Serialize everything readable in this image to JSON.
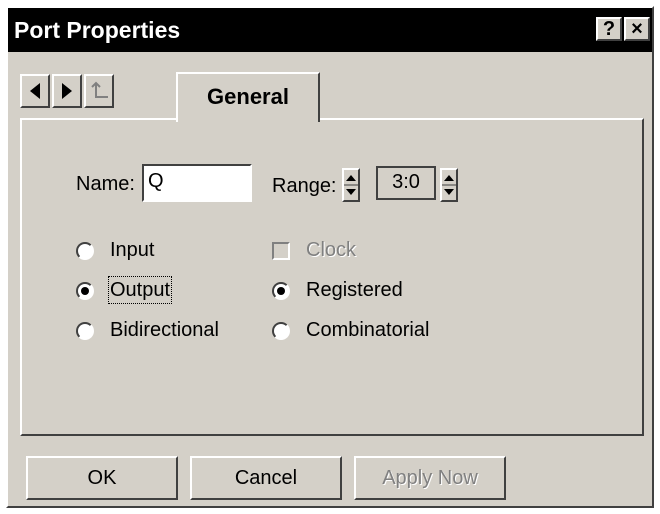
{
  "window": {
    "title": "Port Properties"
  },
  "titlebar": {
    "help_label": "?",
    "close_label": "×"
  },
  "tabs": [
    {
      "label": "General"
    }
  ],
  "nav_icons": [
    "arrow-left-icon",
    "arrow-right-icon",
    "parent-up-icon"
  ],
  "form": {
    "name_label": "Name:",
    "name_value": "Q",
    "range_label": "Range:",
    "range_value": "3:0"
  },
  "direction": {
    "options": [
      "Input",
      "Output",
      "Bidirectional"
    ],
    "selected": "Output"
  },
  "clock": {
    "label": "Clock",
    "checked": false,
    "disabled": true
  },
  "register_type": {
    "options": [
      "Registered",
      "Combinatorial"
    ],
    "selected": "Registered"
  },
  "buttons": {
    "ok": "OK",
    "cancel": "Cancel",
    "apply": "Apply Now"
  },
  "colors": {
    "face": "#d4d0c8",
    "titlebar": "#000000",
    "disabled_text": "#808080"
  }
}
